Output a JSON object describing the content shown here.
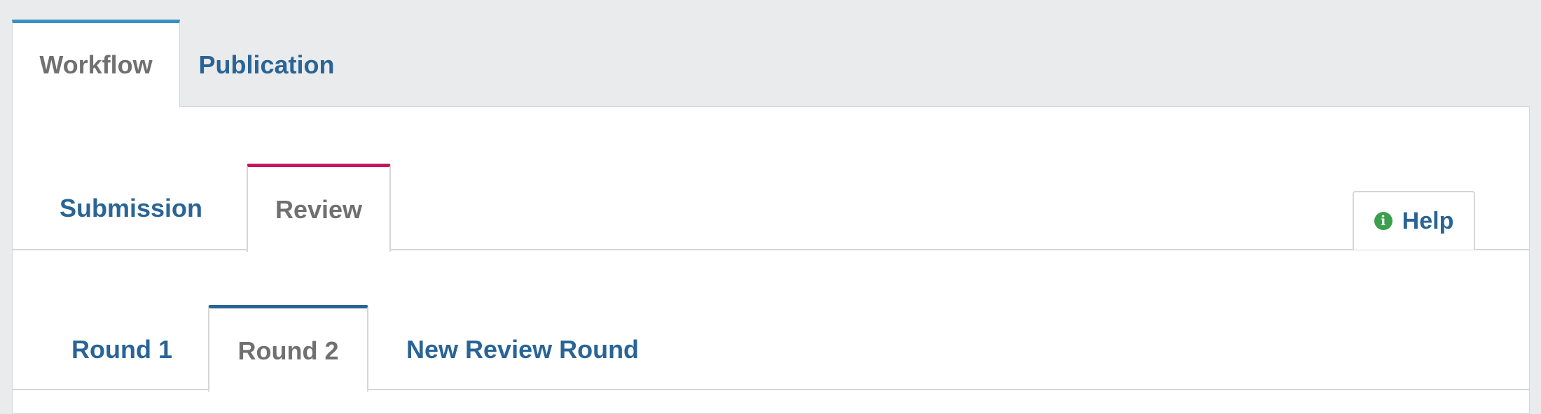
{
  "top_tabs": [
    {
      "label": "Workflow",
      "active": true
    },
    {
      "label": "Publication",
      "active": false
    }
  ],
  "stage_tabs": [
    {
      "label": "Submission",
      "active": false
    },
    {
      "label": "Review",
      "active": true
    }
  ],
  "help": {
    "label": "Help",
    "icon": "info-icon"
  },
  "round_tabs": [
    {
      "label": "Round 1",
      "active": false
    },
    {
      "label": "Round 2",
      "active": true
    },
    {
      "label": "New Review Round",
      "active": false
    }
  ],
  "colors": {
    "link": "#2a6496",
    "inactive_text": "#707070",
    "workflow_accent": "#3b8fc5",
    "review_accent": "#c4175d",
    "round_accent": "#2a6496",
    "info_icon": "#3aa04c",
    "background": "#eaebed"
  }
}
